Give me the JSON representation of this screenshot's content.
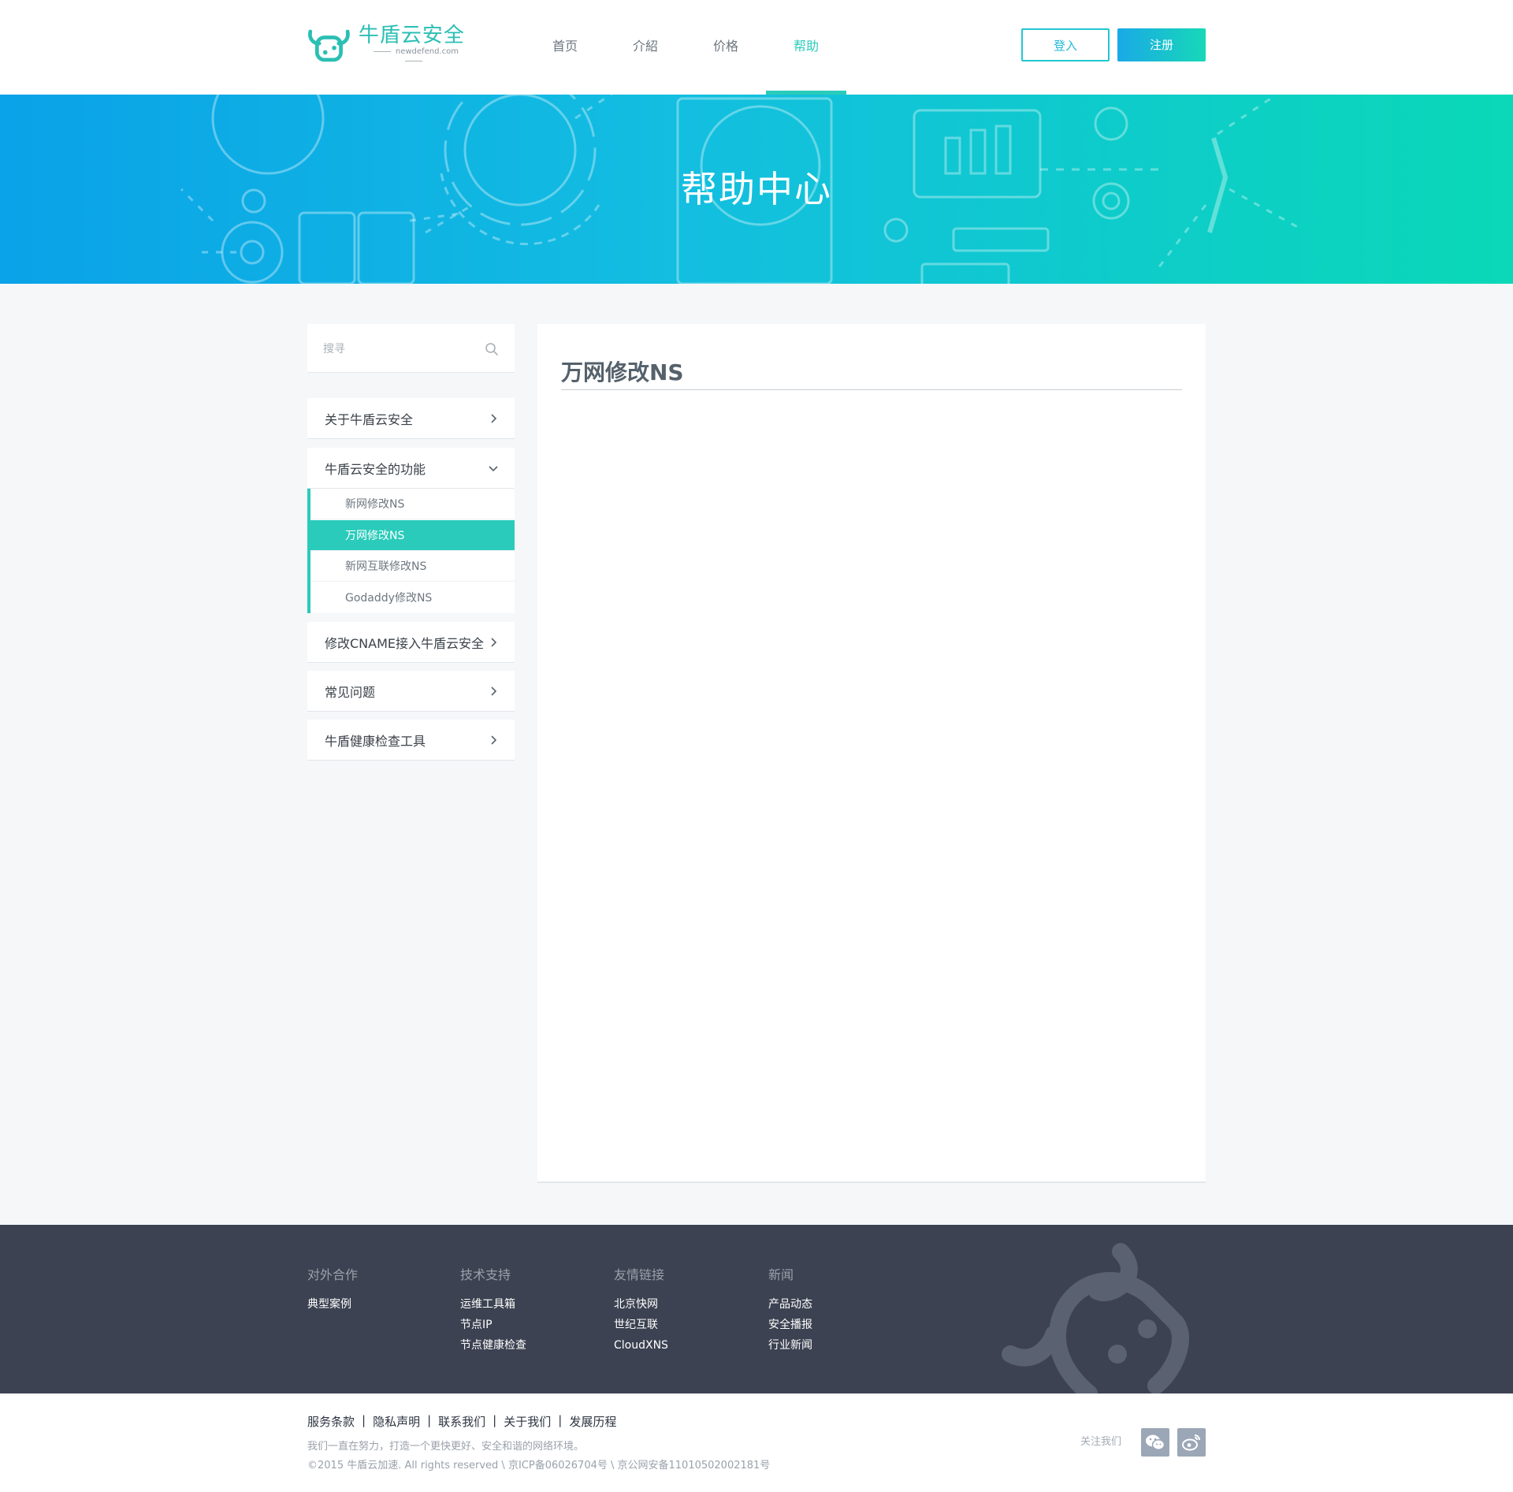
{
  "header": {
    "logo_cn": "牛盾云安全",
    "logo_en": "newdefend.com",
    "nav": [
      {
        "label": "首页"
      },
      {
        "label": "介紹"
      },
      {
        "label": "价格"
      },
      {
        "label": "帮助"
      }
    ],
    "active_nav": "帮助",
    "login_label": "登入",
    "register_label": "注册"
  },
  "banner": {
    "title": "帮助中心"
  },
  "sidebar": {
    "search_placeholder": "搜寻",
    "items": [
      {
        "label": "关于牛盾云安全",
        "expanded": false
      },
      {
        "label": "牛盾云安全的功能",
        "expanded": true,
        "children": [
          {
            "label": "新网修改NS"
          },
          {
            "label": "万网修改NS",
            "active": true
          },
          {
            "label": "新网互联修改NS"
          },
          {
            "label": "Godaddy修改NS"
          }
        ]
      },
      {
        "label": "修改CNAME接入牛盾云安全",
        "expanded": false
      },
      {
        "label": "常见问题",
        "expanded": false
      },
      {
        "label": "牛盾健康检查工具",
        "expanded": false
      }
    ]
  },
  "content": {
    "title": "万网修改NS"
  },
  "footer": {
    "columns": [
      {
        "title": "对外合作",
        "links": [
          "典型案例"
        ]
      },
      {
        "title": "技术支持",
        "links": [
          "运维工具箱",
          "节点IP",
          "节点健康检查"
        ]
      },
      {
        "title": "友情链接",
        "links": [
          "北京快网",
          "世纪互联",
          "CloudXNS"
        ]
      },
      {
        "title": "新闻",
        "links": [
          "产品动态",
          "安全播报",
          "行业新闻"
        ]
      }
    ],
    "legal_links": [
      "服务条款",
      "隐私声明",
      "联系我们",
      "关于我们",
      "发展历程"
    ],
    "slogan": "我们一直在努力，打造一个更快更好、安全和谐的网络环境。",
    "copyright": "©2015 牛盾云加速. All rights reserved \\ 京ICP备06026704号 \\ 京公网安备11010502002181号",
    "follow_label": "关注我们",
    "social": [
      {
        "icon": "wechat-icon"
      },
      {
        "icon": "weibo-icon"
      }
    ]
  },
  "colors": {
    "accent": "#2bcbbb",
    "banner_start": "#0aa2e8",
    "banner_end": "#0ad8b7",
    "footer_bg": "#3c4251"
  }
}
